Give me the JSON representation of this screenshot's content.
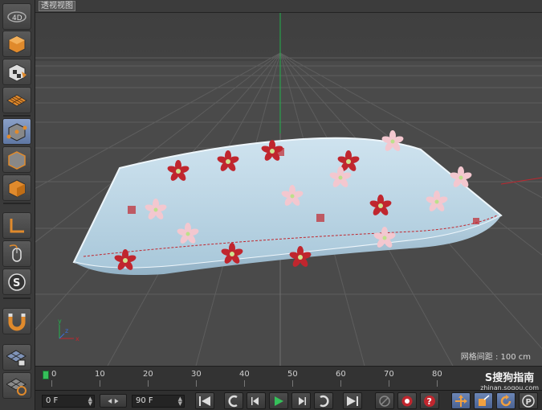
{
  "viewport": {
    "title": "透视视图",
    "grid_spacing": "网格间距 : 100 cm",
    "watermark_main": "S搜狗指南",
    "watermark_sub": "zhinan.sogou.com"
  },
  "toolbar_left": {
    "tools": [
      {
        "name": "cube-icon"
      },
      {
        "name": "checker-cube-icon"
      },
      {
        "name": "grid-plane-icon"
      },
      {
        "name": "vertex-mode-icon"
      },
      {
        "name": "edge-mode-icon"
      },
      {
        "name": "polygon-mode-icon"
      },
      {
        "name": "axis-icon"
      },
      {
        "name": "mouse-icon"
      },
      {
        "name": "snap-s-icon"
      },
      {
        "name": "magnet-icon"
      },
      {
        "name": "lock-grid-icon"
      },
      {
        "name": "rotate-grid-icon"
      }
    ]
  },
  "timeline": {
    "ticks": [
      "0",
      "10",
      "20",
      "30",
      "40",
      "50",
      "60",
      "70",
      "80"
    ],
    "current_frame": "0"
  },
  "controls": {
    "start_frame": "0 F",
    "end_frame": "90 F",
    "buttons": [
      "go-to-start",
      "prev-key",
      "prev-frame",
      "play",
      "next-frame",
      "next-key",
      "go-to-end"
    ],
    "record_buttons": [
      "keyframe-disabled",
      "record",
      "help"
    ],
    "transform_buttons": [
      "move",
      "scale",
      "rotate",
      "param"
    ]
  },
  "colors": {
    "accent_green": "#35c05a",
    "active_tool": "#6f87b7",
    "viewport_bg": "#4b4b4b"
  }
}
